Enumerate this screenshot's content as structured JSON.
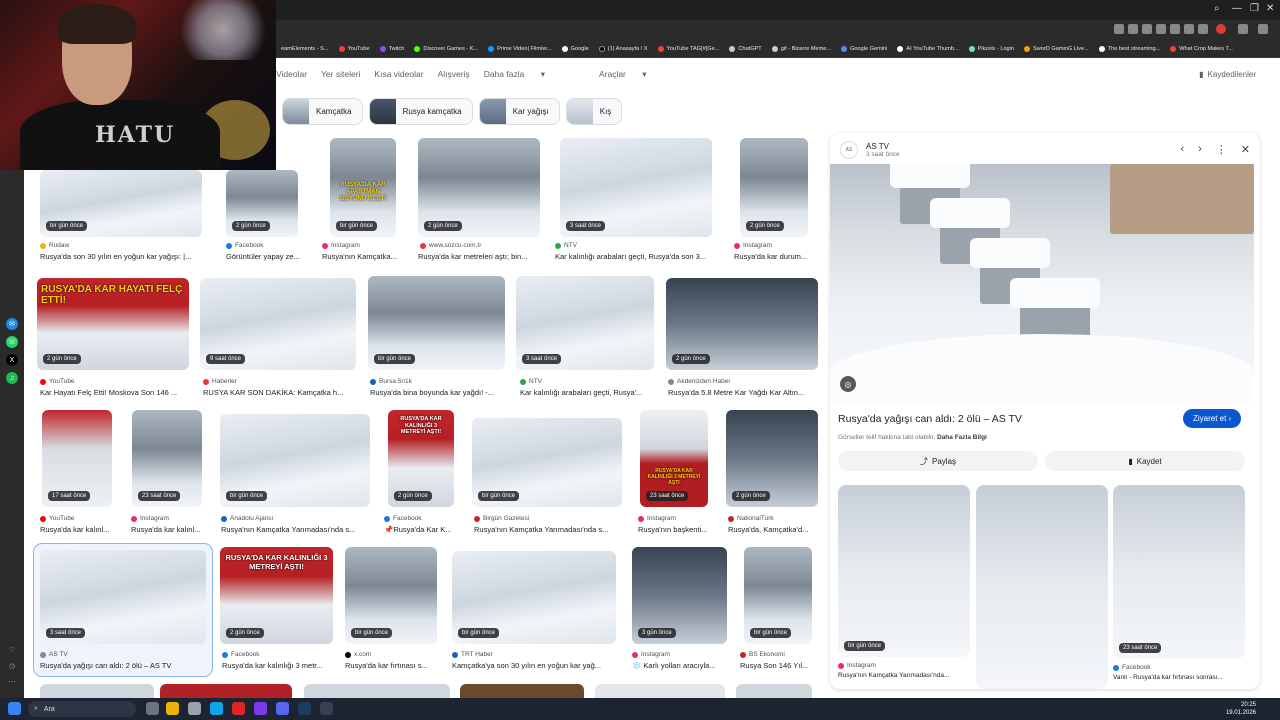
{
  "bookmarks": [
    "eamElements - S...",
    "YouTube",
    "Twitch",
    "Discover Games - K...",
    "Prime Video| Filmler...",
    "Google",
    "(1) Anasayfa / X",
    "YouTube TAG[#]Ge...",
    "ChatGPT",
    "gif - Bizarre Meme...",
    "Google Gemini",
    "AI YouTube Thumb...",
    "Pikzels - Login",
    "SworD GaminG Live...",
    "The best streaming...",
    "What Crop Makes T..."
  ],
  "webcam": {
    "shirt_text": "HATU"
  },
  "nav": {
    "videos": "Videolar",
    "sites": "Yer siteleri",
    "short": "Kısa videolar",
    "shopping": "Alışveriş",
    "more": "Daha fazla",
    "tools": "Araçlar",
    "saved": "Kaydedilenler"
  },
  "chips": [
    "Kamçatka",
    "Rusya kamçatka",
    "Kar yağışı",
    "Kış"
  ],
  "row1": [
    {
      "badge": "bir gün önce",
      "source": "Rudaw",
      "caption": "Rusya'da son 30 yılın en yoğun kar yağışı: |..."
    },
    {
      "badge": "2 gün önce",
      "source": "Facebook",
      "caption": "Görüntüler yapay ze..."
    },
    {
      "badge": "bir gün önce",
      "source": "Instagram",
      "caption": "Rusya'nın Kamçatka...",
      "headline": "RUSYA'DA KAR APARTMAN BOYUNU GEÇTİ"
    },
    {
      "badge": "2 gün önce",
      "source": "www.sozcu.com.tr",
      "caption": "Rusya'da kar metreleri aştı; bin..."
    },
    {
      "badge": "3 saat önce",
      "source": "NTV",
      "caption": "Kar kalınlığı arabaları geçti, Rusya'da son 3..."
    },
    {
      "badge": "2 gün önce",
      "source": "Instagram",
      "caption": "Rusya'da kar durum..."
    }
  ],
  "row2": [
    {
      "badge": "2 gün önce",
      "source": "YouTube",
      "caption": "Kar Hayatı Felç Etti! Moskova Son 146 ...",
      "headline": "RUSYA'DA KAR HAYATI FELÇ ETTİ!"
    },
    {
      "badge": "9 saat önce",
      "source": "Haberler",
      "caption": "RUSYA KAR SON DAKİKA: Kamçatka h..."
    },
    {
      "badge": "bir gün önce",
      "source": "Bursa 5n1k",
      "caption": "Rusya'da bina boyunda kar yağdı! -..."
    },
    {
      "badge": "3 saat önce",
      "source": "NTV",
      "caption": "Kar kalınlığı arabaları geçti, Rusya'..."
    },
    {
      "badge": "2 gün önce",
      "source": "Akdenizden Haber",
      "caption": "Rusya'da 5.8 Metre Kar Yağdı Kar Altın..."
    }
  ],
  "row3": [
    {
      "badge": "17 saat önce",
      "source": "YouTube",
      "caption": "Rusya'da kar kalınl..."
    },
    {
      "badge": "23 saat önce",
      "source": "Instagram",
      "caption": "Rusya'da kar kalınl..."
    },
    {
      "badge": "bir gün önce",
      "source": "Anadolu Ajansı",
      "caption": "Rusya'nın Kamçatka Yarımadası'nda s..."
    },
    {
      "badge": "2 gün önce",
      "source": "Facebook",
      "caption": "📌Rusya'da Kar K...",
      "headline": "RUSYA'DA KAR KALINLIĞI 3 METREYİ AŞTI!"
    },
    {
      "badge": "bir gün önce",
      "source": "Birgün Gazetesi",
      "caption": "Rusya'nın Kamçatka Yarımadası'nda s..."
    },
    {
      "badge": "23 saat önce",
      "source": "Instagram",
      "caption": "Rusya'nın başkenti...",
      "headline": "RUSYA'DA KAR KALINLIĞI 3 METREYİ AŞTI"
    },
    {
      "badge": "2 gün önce",
      "source": "NationalTurk",
      "caption": "Rusya'da, Kamçatka'd..."
    }
  ],
  "row4": [
    {
      "badge": "3 saat önce",
      "source": "AS TV",
      "caption": "Rusya'da yağışı can aldı: 2 ölü – AS TV"
    },
    {
      "badge": "2 gün önce",
      "source": "Facebook",
      "caption": "Rusya'da kar kalınlığı 3 metr...",
      "headline": "RUSYA'DA KAR KALINLIĞI 3 METREYİ AŞTI!"
    },
    {
      "badge": "bir gün önce",
      "source": "x.com",
      "caption": "Rusya'da kar fırtınası s..."
    },
    {
      "badge": "bir gün önce",
      "source": "TRT Haber",
      "caption": "Kamçatka'ya son 30 yılın en yoğun kar yağ..."
    },
    {
      "badge": "3 gün önce",
      "source": "Instagram",
      "caption": "❄️ Karlı yolları aracıyla..."
    },
    {
      "badge": "bir gün önce",
      "source": "BS Ekonomi",
      "caption": "Rusya Son 146 Yıl..."
    }
  ],
  "panel": {
    "source": "AS TV",
    "time": "3 saat önce",
    "title": "Rusya'da yağışı can aldı: 2 ölü – AS TV",
    "visit": "Ziyaret et",
    "note": "Görseller telif hakkına tabi olabilir.",
    "more_info": "Daha Fazla Bilgi",
    "share": "Paylaş",
    "save": "Kaydet",
    "related": [
      {
        "badge": "bir gün önce",
        "source": "Instagram",
        "caption": "Rusya'nın Kamçatka Yarımadası'nda..."
      },
      {
        "badge": "",
        "source": "",
        "caption": ""
      },
      {
        "badge": "23 saat önce",
        "source": "Facebook",
        "caption": "Vanlı - Rusya'da kar fırtınası sonrası..."
      }
    ]
  },
  "taskbar": {
    "search": "Ara",
    "time": "20:25",
    "date": "19.01.2026"
  }
}
